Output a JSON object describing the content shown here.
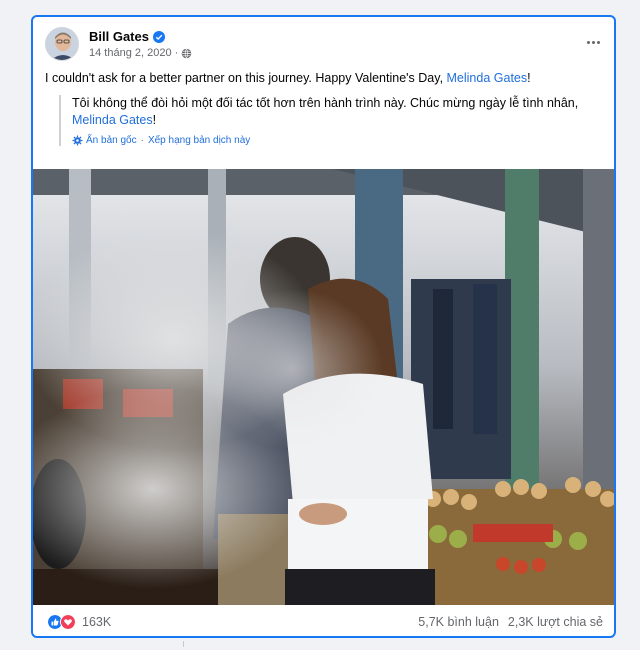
{
  "post": {
    "author": "Bill Gates",
    "date": "14 tháng 2, 2020",
    "separator": "·",
    "caption_text": "I couldn't ask for a better partner on this journey. Happy Valentine's Day, ",
    "caption_mention": "Melinda Gates",
    "caption_end": "!",
    "translation_text": "Tôi không thể đòi hỏi một đối tác tốt hơn trên hành trình này. Chúc mừng ngày lễ tình nhân, ",
    "translation_mention": "Melinda Gates",
    "translation_end": "!",
    "see_original": "Ẩn bản gốc",
    "tool_separator": "·",
    "rate_translation": "Xếp hạng bản dịch này",
    "reaction_count": "163K",
    "comments": "5,7K bình luận",
    "shares": "2,3K lượt chia sẻ"
  },
  "icons": {
    "verified": "verified-badge-icon",
    "privacy": "globe-icon",
    "more": "more-options-icon",
    "translate": "gear-icon",
    "like": "like-icon",
    "love": "love-icon"
  },
  "colors": {
    "accent": "#1877f2",
    "link": "#216fdb",
    "secondary_text": "#65676b",
    "love": "#f33e58"
  }
}
